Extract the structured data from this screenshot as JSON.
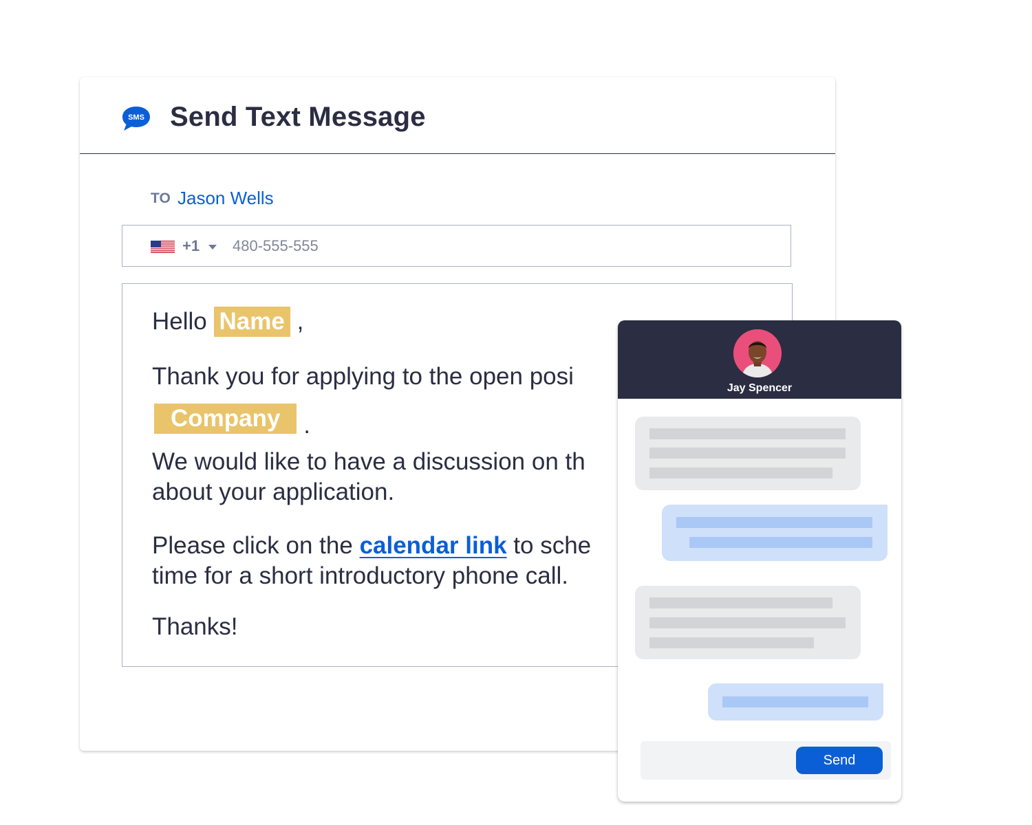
{
  "dialog": {
    "title": "Send Text Message",
    "icon": "sms-chat-icon",
    "icon_text": "SMS",
    "to_label": "TO",
    "recipient": "Jason Wells"
  },
  "phone": {
    "flag": "us-flag-icon",
    "country_code": "+1",
    "placeholder": "480-555-555"
  },
  "message": {
    "greeting": "Hello",
    "name_token": "Name",
    "greeting_end": ",",
    "line_thanks": "Thank you for applying to the open posi",
    "company_token": "Company",
    "company_end": ".",
    "line_discuss_1": "We would like to have a discussion on th",
    "line_discuss_2": "about your application.",
    "line_click_pre": "Please click on the",
    "link_text": "calendar link",
    "line_click_post": "to sche",
    "line_call": "time for a short introductory phone call.",
    "signoff": "Thanks!"
  },
  "chat": {
    "contact_name": "Jay Spencer",
    "avatar": "avatar-photo",
    "send_label": "Send"
  },
  "colors": {
    "accent": "#0b5fd6",
    "dark": "#2b2d42",
    "token": "#e9c46a",
    "avatar_bg": "#e94f7a",
    "bubble_in": "#e9eaec",
    "bubble_out": "#cfe0fb"
  }
}
